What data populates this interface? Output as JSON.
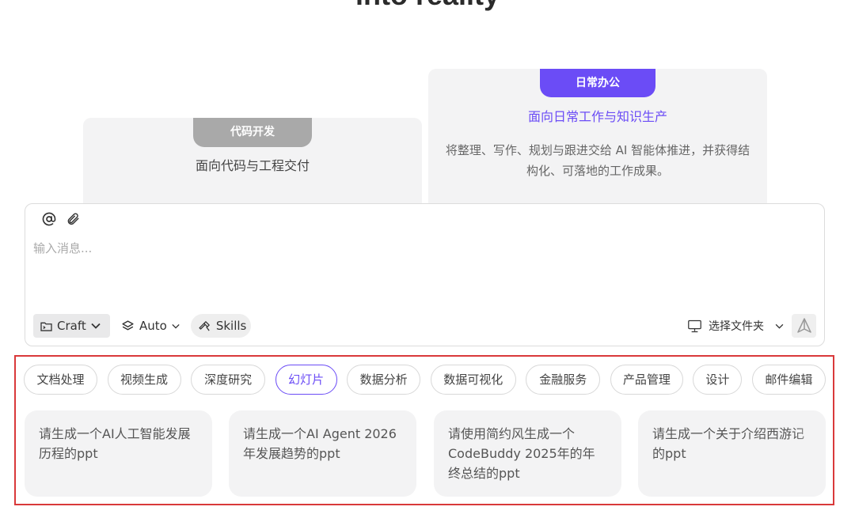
{
  "hero": {
    "title": "into reality"
  },
  "modes": {
    "code": {
      "tab": "代码开发",
      "subtitle": "面向代码与工程交付"
    },
    "office": {
      "tab": "日常办公",
      "subtitle": "面向日常工作与知识生产",
      "description": "将整理、写作、规划与跟进交给 AI 智能体推进，并获得结构化、可落地的工作成果。"
    }
  },
  "composer": {
    "placeholder": "输入消息...",
    "mode_label": "Craft",
    "model_label": "Auto",
    "skills_label": "Skills",
    "folder_label": "选择文件夹"
  },
  "categories": [
    "文档处理",
    "视频生成",
    "深度研究",
    "幻灯片",
    "数据分析",
    "数据可视化",
    "金融服务",
    "产品管理",
    "设计",
    "邮件编辑"
  ],
  "active_category": "幻灯片",
  "prompts": [
    "请生成一个AI人工智能发展历程的ppt",
    "请生成一个AI Agent 2026年发展趋势的ppt",
    "请使用简约风生成一个CodeBuddy 2025年的年终总结的ppt",
    "请生成一个关于介绍西游记的ppt"
  ],
  "colors": {
    "accent": "#6b4cf6",
    "highlight_border": "#d9393a"
  }
}
